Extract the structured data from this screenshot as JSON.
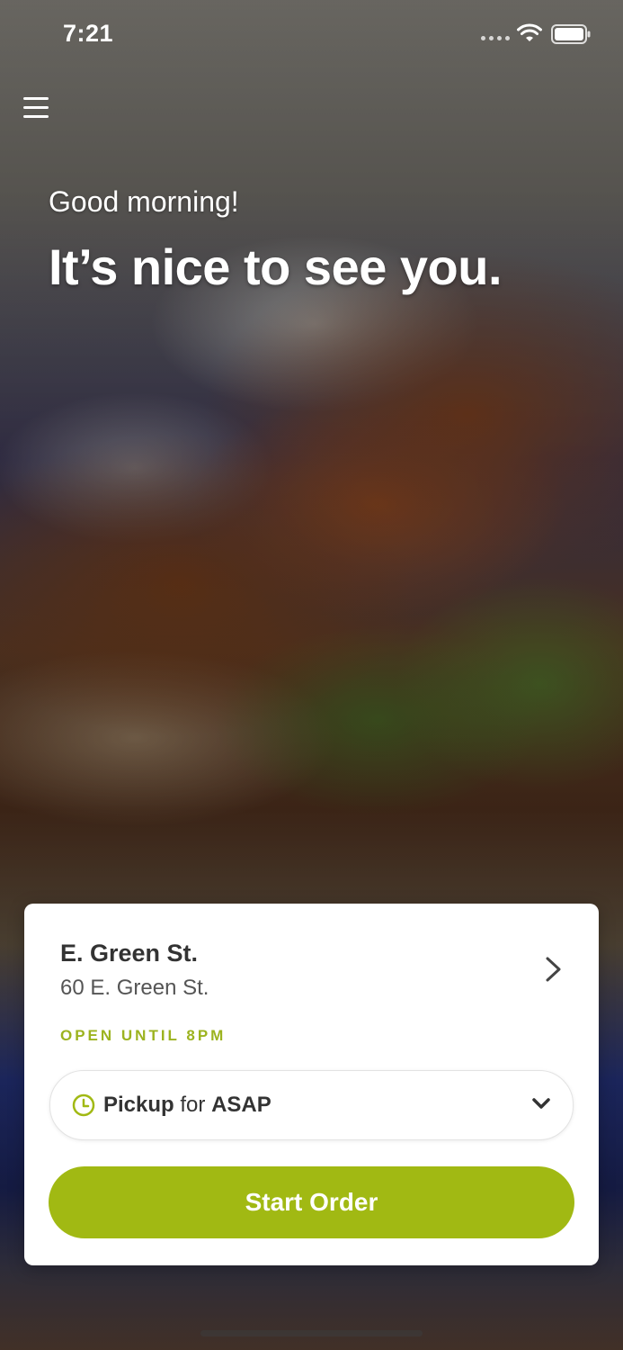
{
  "status_bar": {
    "time": "7:21",
    "wifi_icon": "wifi-icon",
    "battery_icon": "battery-icon"
  },
  "header": {
    "menu_icon": "hamburger-menu-icon"
  },
  "hero": {
    "greeting": "Good morning!",
    "headline": "It’s nice to see you."
  },
  "location": {
    "name": "E. Green St.",
    "address": "60 E. Green St.",
    "hours": "OPEN UNTIL 8PM"
  },
  "pickup": {
    "mode": "Pickup",
    "connector": "for",
    "time": "ASAP"
  },
  "actions": {
    "start_order_label": "Start Order"
  },
  "colors": {
    "accent": "#a1b913",
    "hours_text": "#9cb31f",
    "card_bg": "#ffffff",
    "text_dark": "#333333"
  }
}
